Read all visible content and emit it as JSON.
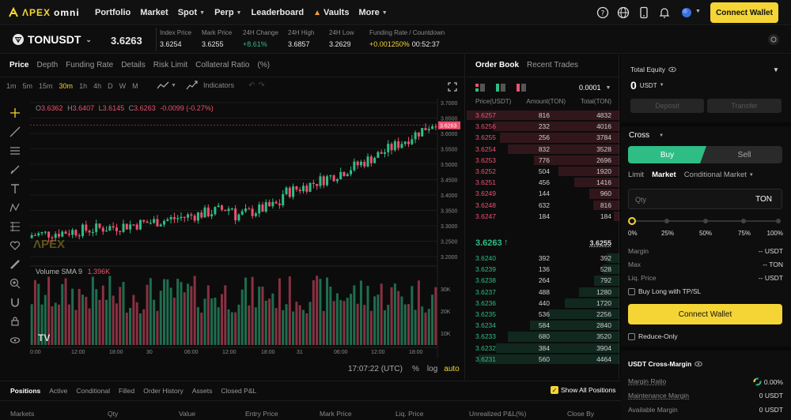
{
  "nav": {
    "logo_a": "ΛPEX",
    "logo_b": "omni",
    "items": [
      {
        "label": "Portfolio",
        "caret": false
      },
      {
        "label": "Market",
        "caret": false
      },
      {
        "label": "Spot",
        "caret": true
      },
      {
        "label": "Perp",
        "caret": true
      },
      {
        "label": "Leaderboard",
        "caret": false
      },
      {
        "label": "Vaults",
        "caret": false
      },
      {
        "label": "More",
        "caret": true
      }
    ],
    "connect_label": "Connect Wallet"
  },
  "ticker": {
    "symbol": "TONUSDT",
    "last_price": "3.6263",
    "stats": [
      {
        "label": "Index Price",
        "value": "3.6254",
        "color": "#e8e8e8"
      },
      {
        "label": "Mark Price",
        "value": "3.6255",
        "color": "#e8e8e8"
      },
      {
        "label": "24H Change",
        "value": "+8.61%",
        "color": "#2ebd85"
      },
      {
        "label": "24H High",
        "value": "3.6857",
        "color": "#e8e8e8"
      },
      {
        "label": "24H Low",
        "value": "3.2629",
        "color": "#e8e8e8"
      },
      {
        "label": "Funding Rate / Countdown",
        "value_a": "+0.001250%",
        "value_b": "00:52:37",
        "color": "#f4d535"
      }
    ]
  },
  "chart_tabs": [
    "Price",
    "Depth",
    "Funding Rate",
    "Details",
    "Risk Limit",
    "Collateral Ratio",
    "(%)"
  ],
  "intervals": [
    "1m",
    "5m",
    "15m",
    "30m",
    "1h",
    "4h",
    "D",
    "W",
    "M"
  ],
  "active_interval": "30m",
  "indicators_label": "Indicators",
  "ohlc": {
    "o": "3.6362",
    "h": "3.6407",
    "l": "3.6145",
    "c": "3.6263",
    "chg": "-0.0099 (-0.27%)"
  },
  "volume_label": "Volume SMA 9",
  "volume_value": "1.396K",
  "chart_time": "17:07:22 (UTC)",
  "chart_opts": [
    "%",
    "log",
    "auto"
  ],
  "price_ticks": [
    "3.7000",
    "3.6500",
    "3.6000",
    "3.5500",
    "3.5000",
    "3.4500",
    "3.4000",
    "3.3500",
    "3.3000",
    "3.2500",
    "3.2000"
  ],
  "price_marker": "3.6263",
  "vol_ticks": [
    "30K",
    "20K",
    "10K"
  ],
  "time_ticks": [
    "0:00",
    "12:00",
    "18:00",
    "30",
    "06:00",
    "12:00",
    "18:00",
    "31",
    "06:00",
    "12:00",
    "18:00"
  ],
  "watermark": "ΛPEX",
  "orderbook": {
    "tabs": [
      "Order Book",
      "Recent Trades"
    ],
    "tick_size": "0.0001",
    "headers": [
      "Price(USDT)",
      "Amount(TON)",
      "Total(TON)"
    ],
    "asks": [
      {
        "p": "3.6257",
        "a": "816",
        "t": "4832"
      },
      {
        "p": "3.6256",
        "a": "232",
        "t": "4016"
      },
      {
        "p": "3.6255",
        "a": "256",
        "t": "3784"
      },
      {
        "p": "3.6254",
        "a": "832",
        "t": "3528"
      },
      {
        "p": "3.6253",
        "a": "776",
        "t": "2696"
      },
      {
        "p": "3.6252",
        "a": "504",
        "t": "1920"
      },
      {
        "p": "3.6251",
        "a": "456",
        "t": "1416"
      },
      {
        "p": "3.6249",
        "a": "144",
        "t": "960"
      },
      {
        "p": "3.6248",
        "a": "632",
        "t": "816"
      },
      {
        "p": "3.6247",
        "a": "184",
        "t": "184"
      }
    ],
    "mid_price": "3.6263",
    "mid_arrow": "↑",
    "mid_mark": "3.6255",
    "bids": [
      {
        "p": "3.6240",
        "a": "392",
        "t": "392"
      },
      {
        "p": "3.6239",
        "a": "136",
        "t": "528"
      },
      {
        "p": "3.6238",
        "a": "264",
        "t": "792"
      },
      {
        "p": "3.6237",
        "a": "488",
        "t": "1280"
      },
      {
        "p": "3.6236",
        "a": "440",
        "t": "1720"
      },
      {
        "p": "3.6235",
        "a": "536",
        "t": "2256"
      },
      {
        "p": "3.6234",
        "a": "584",
        "t": "2840"
      },
      {
        "p": "3.6233",
        "a": "680",
        "t": "3520"
      },
      {
        "p": "3.6232",
        "a": "384",
        "t": "3904"
      },
      {
        "p": "3.6231",
        "a": "560",
        "t": "4464"
      }
    ]
  },
  "account": {
    "equity_label": "Total Equity",
    "equity_value": "0",
    "equity_unit": "USDT",
    "deposit_label": "Deposit",
    "transfer_label": "Transfer",
    "margin_mode": "Cross",
    "buy_label": "Buy",
    "sell_label": "Sell",
    "order_types": [
      "Limit",
      "Market",
      "Conditional Market"
    ],
    "qty_placeholder": "Qty",
    "qty_unit": "TON",
    "slider_marks": [
      "0%",
      "25%",
      "50%",
      "75%",
      "100%"
    ],
    "rows": [
      {
        "label": "Margin",
        "value": "-- USDT"
      },
      {
        "label": "Max",
        "value": "-- TON"
      },
      {
        "label": "Liq. Price",
        "value": "-- USDT"
      }
    ],
    "tpsl_label": "Buy Long with TP/SL",
    "connect_label": "Connect Wallet",
    "reduce_only_label": "Reduce-Only",
    "cross_margin_title": "USDT Cross-Margin",
    "margin_ratio_label": "Margin Ratio",
    "margin_ratio_value": "0.00%",
    "maint_margin_label": "Maintenance Margin",
    "maint_margin_value": "0 USDT",
    "avail_margin_label": "Available Margin",
    "avail_margin_value": "0 USDT"
  },
  "positions": {
    "tabs": [
      "Positions",
      "Active",
      "Conditional",
      "Filled",
      "Order History",
      "Assets",
      "Closed P&L"
    ],
    "show_all_label": "Show All Positions",
    "columns": [
      "Markets",
      "Qty",
      "Value",
      "Entry Price",
      "Mark Price",
      "Liq. Price",
      "Unrealized P&L(%)",
      "Close By"
    ]
  },
  "colors": {
    "up": "#2ebd85",
    "down": "#f0506e",
    "accent": "#f4d535"
  }
}
